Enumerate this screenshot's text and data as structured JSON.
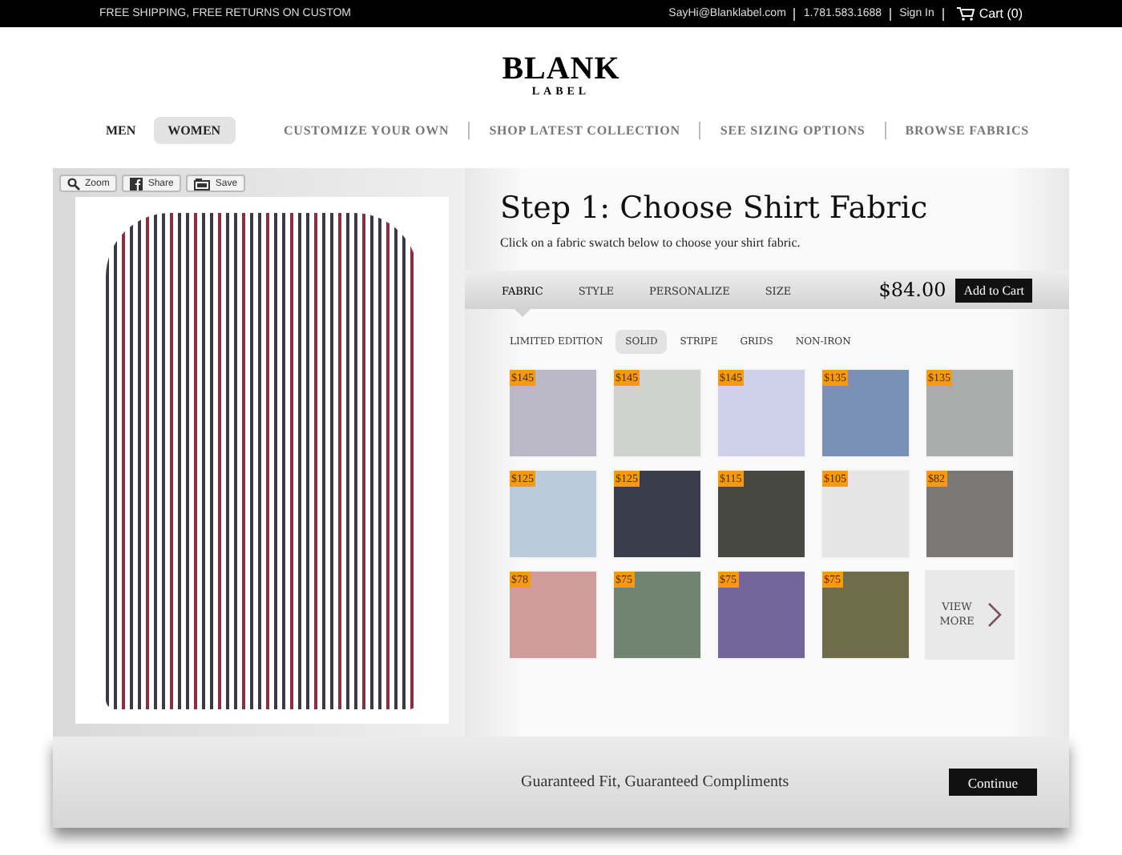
{
  "top_bar": {
    "promo": "FREE SHIPPING, FREE RETURNS ON CUSTOM",
    "email": "SayHi@Blanklabel.com",
    "phone": "1.781.583.1688",
    "sign_in": "Sign In",
    "cart": "Cart (0)"
  },
  "logo": {
    "name": "BLANK",
    "sub": "LABEL"
  },
  "gender_tabs": [
    {
      "label": "MEN",
      "selected": false
    },
    {
      "label": "WOMEN",
      "selected": true
    }
  ],
  "nav": [
    "CUSTOMIZE YOUR OWN",
    "SHOP LATEST COLLECTION",
    "SEE SIZING OPTIONS",
    "BROWSE FABRICS"
  ],
  "preview_tools": [
    {
      "kind": "zoom",
      "label": "Zoom"
    },
    {
      "kind": "share",
      "label": "Share"
    },
    {
      "kind": "save",
      "label": "Save"
    }
  ],
  "step": {
    "title": "Step 1: Choose Shirt Fabric",
    "hint": "Click on a fabric swatch below to choose your shirt fabric."
  },
  "steps": [
    {
      "label": "FABRIC",
      "selected": true
    },
    {
      "label": "STYLE",
      "selected": false
    },
    {
      "label": "PERSONALIZE",
      "selected": false
    },
    {
      "label": "SIZE",
      "selected": false
    }
  ],
  "price": "$84.00",
  "add_to_cart": "Add to Cart",
  "filters": [
    {
      "label": "LIMITED EDITION",
      "selected": false
    },
    {
      "label": "SOLID",
      "selected": true
    },
    {
      "label": "STRIPE",
      "selected": false
    },
    {
      "label": "GRIDS",
      "selected": false
    },
    {
      "label": "NON-IRON",
      "selected": false
    }
  ],
  "swatches": [
    {
      "price": "$145",
      "color": "#b9b8c4"
    },
    {
      "price": "$145",
      "color": "#cfd2cf"
    },
    {
      "price": "$145",
      "color": "#cfd0ea"
    },
    {
      "price": "$135",
      "color": "#7891b5"
    },
    {
      "price": "$135",
      "color": "#a9acaa"
    },
    {
      "price": "$125",
      "color": "#bccbdc"
    },
    {
      "price": "$125",
      "color": "#393d4c"
    },
    {
      "price": "$115",
      "color": "#474940"
    },
    {
      "price": "$105",
      "color": "#e5e5e6"
    },
    {
      "price": "$82",
      "color": "#7a7876"
    },
    {
      "price": "$78",
      "color": "#d19c9c"
    },
    {
      "price": "$75",
      "color": "#6f8370"
    },
    {
      "price": "$75",
      "color": "#73669a"
    },
    {
      "price": "$75",
      "color": "#6f6c4a"
    }
  ],
  "view_more": "VIEW MORE",
  "footer": {
    "tagline": "Guaranteed Fit, Guaranteed Compliments",
    "continue": "Continue"
  }
}
